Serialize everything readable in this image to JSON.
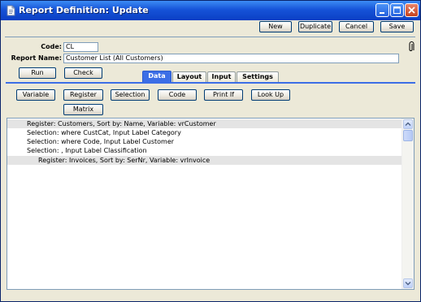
{
  "window": {
    "title": "Report Definition: Update"
  },
  "toolbar": {
    "new_label": "New",
    "duplicate_label": "Duplicate",
    "cancel_label": "Cancel",
    "save_label": "Save"
  },
  "form": {
    "code_label": "Code:",
    "code_value": "CL",
    "report_name_label": "Report Name:",
    "report_name_value": "Customer List (All Customers)"
  },
  "actions": {
    "run_label": "Run",
    "check_label": "Check"
  },
  "tabs": [
    {
      "label": "Data",
      "active": true
    },
    {
      "label": "Layout",
      "active": false
    },
    {
      "label": "Input",
      "active": false
    },
    {
      "label": "Settings",
      "active": false
    }
  ],
  "data_buttons": {
    "variable": "Variable",
    "register": "Register",
    "selection": "Selection",
    "code": "Code",
    "print_if": "Print If",
    "look_up": "Look Up",
    "matrix": "Matrix"
  },
  "definition_rows": [
    {
      "text": "Register: Customers, Sort by: Name, Variable: vrCustomer",
      "indent": 1,
      "selected": true
    },
    {
      "text": "Selection: where CustCat, Input Label Category",
      "indent": 1,
      "selected": false
    },
    {
      "text": "Selection: where Code, Input Label Customer",
      "indent": 1,
      "selected": false
    },
    {
      "text": "Selection: , Input Label Classification",
      "indent": 1,
      "selected": false
    },
    {
      "text": "Register: Invoices, Sort by: SerNr, Variable: vrInvoice",
      "indent": 2,
      "selected": true
    }
  ],
  "colors": {
    "titlebar": "#1653d8",
    "active_tab": "#3c6ee6",
    "selected_row": "#e4e4e4"
  },
  "icons": {
    "window": "document-icon",
    "attachment": "paperclip-icon"
  }
}
